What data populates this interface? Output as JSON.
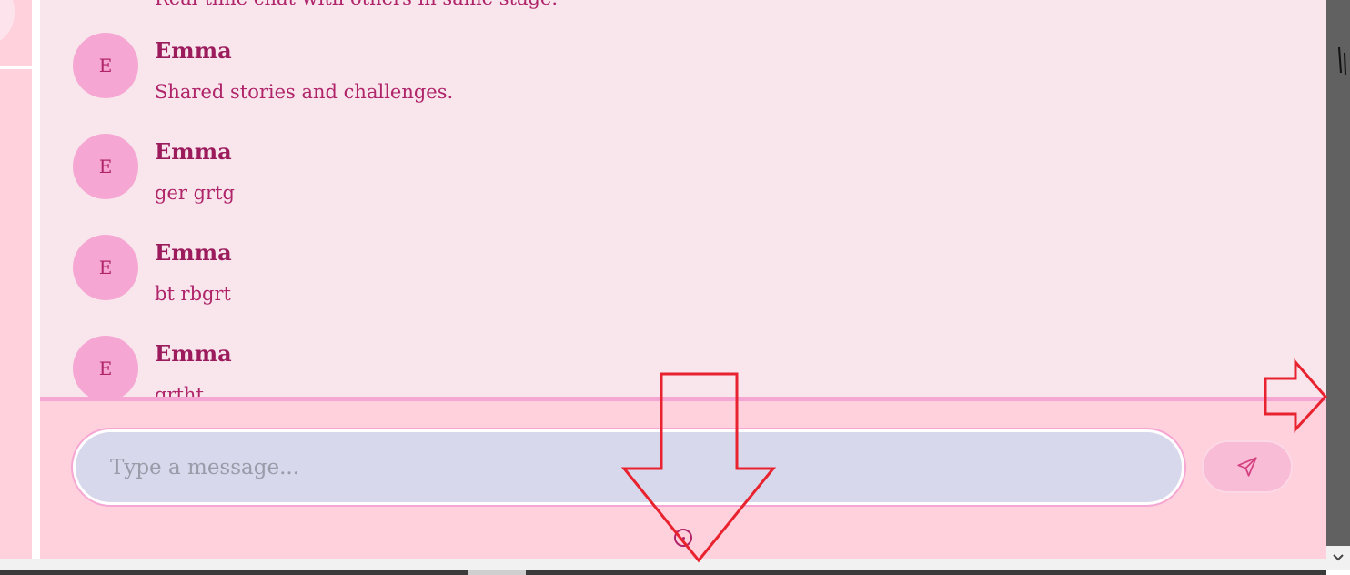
{
  "partial_message": "Real-time chat with others in same stage.",
  "messages": [
    {
      "initial": "E",
      "author": "Emma",
      "text": "Shared stories and challenges."
    },
    {
      "initial": "E",
      "author": "Emma",
      "text": "ger grtg"
    },
    {
      "initial": "E",
      "author": "Emma",
      "text": "bt rbgrt"
    },
    {
      "initial": "E",
      "author": "Emma",
      "text": "grtht"
    }
  ],
  "composer": {
    "placeholder": "Type a message...",
    "value": ""
  },
  "icons": {
    "send": "send-icon",
    "scroll_down": "chevron-down-icon"
  },
  "colors": {
    "accent": "#9b1b5c",
    "text": "#b0246a",
    "avatar": "#f6a6d2",
    "panel": "#ffd1dc",
    "messages_bg": "#f8e6ec",
    "annotation": "#e8232f"
  }
}
